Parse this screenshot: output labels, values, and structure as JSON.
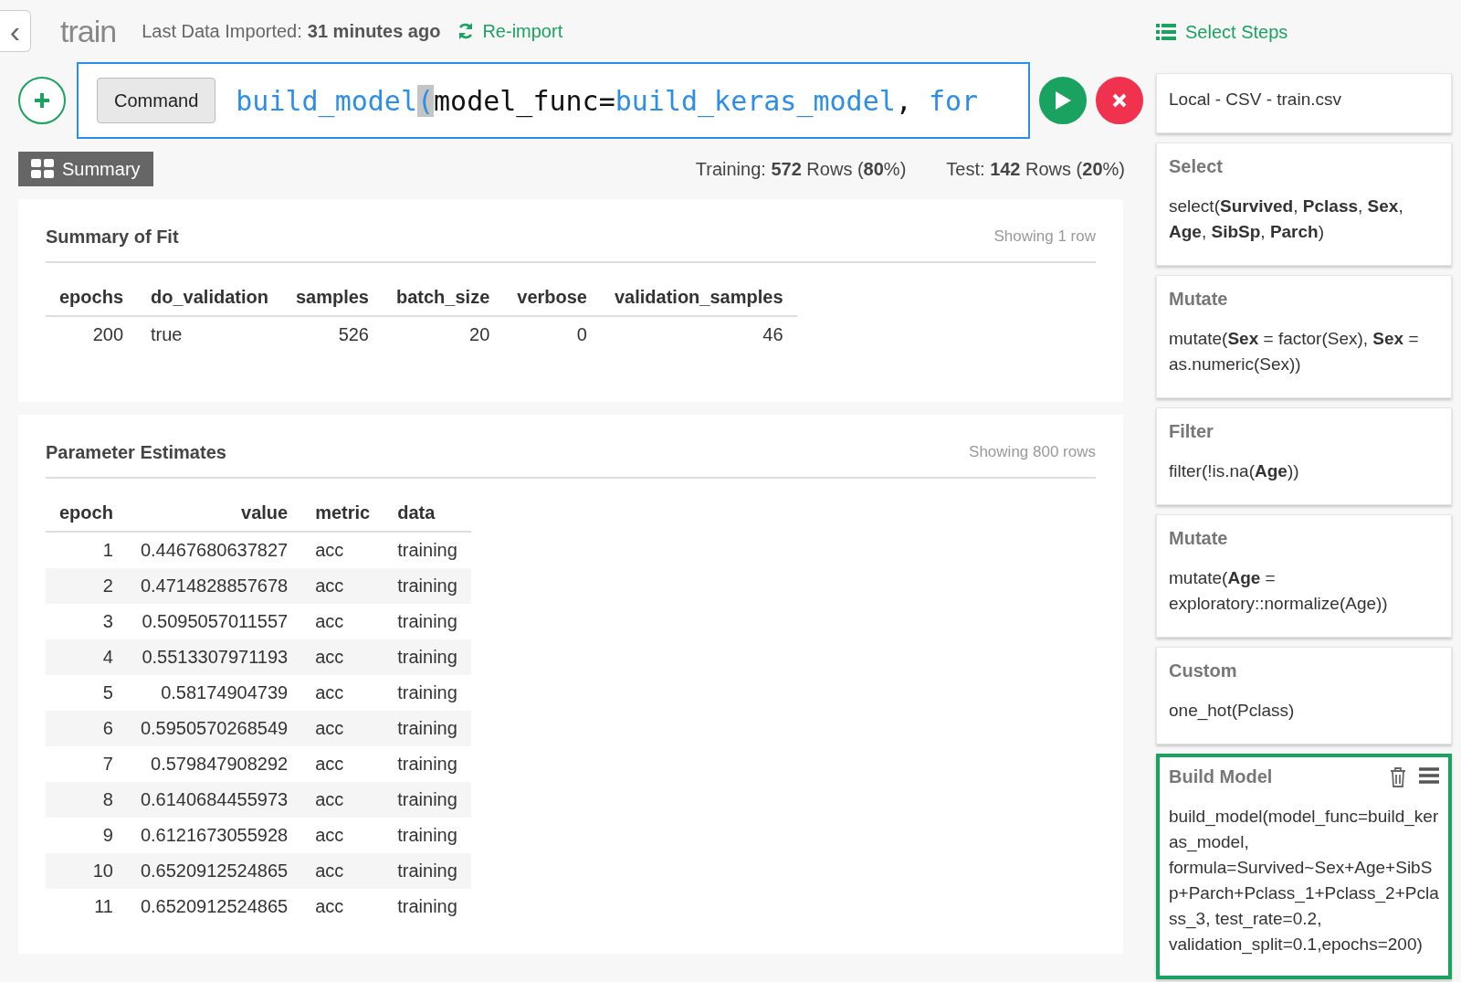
{
  "header": {
    "back": "‹",
    "title": "train",
    "import_label": "Last Data Imported:",
    "import_time": "31 minutes ago",
    "reimport": "Re-import"
  },
  "command": {
    "type_button": "Command",
    "tokens": [
      {
        "text": "build_model",
        "kind": "func"
      },
      {
        "text": "(",
        "kind": "cursor"
      },
      {
        "text": "model_func=",
        "kind": "plain"
      },
      {
        "text": "build_keras_model",
        "kind": "func"
      },
      {
        "text": ", ",
        "kind": "plain"
      },
      {
        "text": "for",
        "kind": "func"
      }
    ]
  },
  "view_button": "Summary",
  "split": {
    "training_label": "Training:",
    "training": "**572** Rows (**80**%)",
    "test_label": "Test:",
    "test": "**142** Rows (**20**%)"
  },
  "summary_of_fit": {
    "title": "Summary of Fit",
    "count": "Showing 1 row",
    "columns": [
      {
        "label": "epochs",
        "numeric": true
      },
      {
        "label": "do_validation",
        "numeric": false
      },
      {
        "label": "samples",
        "numeric": true
      },
      {
        "label": "batch_size",
        "numeric": true
      },
      {
        "label": "verbose",
        "numeric": true
      },
      {
        "label": "validation_samples",
        "numeric": true
      }
    ],
    "rows": [
      [
        "200",
        "true",
        "526",
        "20",
        "0",
        "46"
      ]
    ]
  },
  "parameter_estimates": {
    "title": "Parameter Estimates",
    "count": "Showing 800 rows",
    "columns": [
      {
        "label": "epoch",
        "numeric": true
      },
      {
        "label": "value",
        "numeric": true
      },
      {
        "label": "metric",
        "numeric": false
      },
      {
        "label": "data",
        "numeric": false
      }
    ],
    "rows": [
      [
        "1",
        "0.4467680637827",
        "acc",
        "training"
      ],
      [
        "2",
        "0.4714828857678",
        "acc",
        "training"
      ],
      [
        "3",
        "0.5095057011557",
        "acc",
        "training"
      ],
      [
        "4",
        "0.5513307971193",
        "acc",
        "training"
      ],
      [
        "5",
        "0.58174904739",
        "acc",
        "training"
      ],
      [
        "6",
        "0.5950570268549",
        "acc",
        "training"
      ],
      [
        "7",
        "0.579847908292",
        "acc",
        "training"
      ],
      [
        "8",
        "0.6140684455973",
        "acc",
        "training"
      ],
      [
        "9",
        "0.6121673055928",
        "acc",
        "training"
      ],
      [
        "10",
        "0.6520912524865",
        "acc",
        "training"
      ],
      [
        "11",
        "0.6520912524865",
        "acc",
        "training"
      ]
    ]
  },
  "sidebar": {
    "title": "Select Steps",
    "steps": [
      {
        "body": "Local - CSV - train.csv",
        "selected": false
      },
      {
        "title": "Select",
        "body": "select(**Survived**, **Pclass**, **Sex**, **Age**, **SibSp**, **Parch**)",
        "selected": false
      },
      {
        "title": "Mutate",
        "body": "mutate(**Sex** = factor(Sex), **Sex** = as.numeric(Sex))",
        "selected": false
      },
      {
        "title": "Filter",
        "body": "filter(!is.na(**Age**))",
        "selected": false
      },
      {
        "title": "Mutate",
        "body": "mutate(**Age** = exploratory::normalize(Age))",
        "selected": false
      },
      {
        "title": "Custom",
        "body": "one_hot(Pclass)",
        "selected": false
      },
      {
        "title": "Build Model",
        "body": "build_model(model_func=build_keras_model, formula=Survived~Sex+Age+SibSp+Parch+Pclass_1+Pclass_2+Pclass_3, test_rate=0.2, validation_split=0.1,epochs=200)",
        "selected": true
      }
    ]
  }
}
